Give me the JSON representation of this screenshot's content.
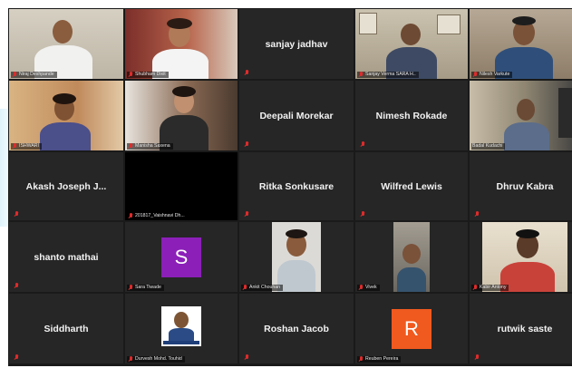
{
  "participants": [
    {
      "name": "Niraj Deshpande",
      "type": "video",
      "bg": "#c9c3b5"
    },
    {
      "name": "Shubham Dixit",
      "type": "video",
      "bg": "#a0523f"
    },
    {
      "name": "sanjay jadhav",
      "type": "name"
    },
    {
      "name": "Sanjay Verma SARA H..",
      "type": "video",
      "bg": "#bfb7a6"
    },
    {
      "name": "Nilesh Varkute",
      "type": "video",
      "bg": "#9a8b78"
    },
    {
      "name": "ISHWARI",
      "type": "video",
      "bg": "#c49b6c"
    },
    {
      "name": "Manisha Saxena",
      "type": "video",
      "bg": "#6b5646"
    },
    {
      "name": "Deepali Morekar",
      "type": "name"
    },
    {
      "name": "Nimesh Rokade",
      "type": "name"
    },
    {
      "name": "Badal Kudachi",
      "type": "video",
      "bg": "#7d7463",
      "active": true
    },
    {
      "name": "Akash Joseph J...",
      "type": "name"
    },
    {
      "name": "201817_Vaishnavi Dh...",
      "type": "blank"
    },
    {
      "name": "Ritka Sonkusare",
      "type": "name"
    },
    {
      "name": "Wilfred Lewis",
      "type": "name"
    },
    {
      "name": "Dhruv Kabra",
      "type": "name"
    },
    {
      "name": "shanto mathai",
      "type": "name"
    },
    {
      "name": "Sara Tiwade",
      "type": "letter",
      "letter": "S",
      "color": "#8b1fb8"
    },
    {
      "name": "Ankit Chouhan",
      "type": "video",
      "bg": "#d4d2cf"
    },
    {
      "name": "Vivek",
      "type": "video",
      "bg": "#8f8a80"
    },
    {
      "name": "Kabir Antony",
      "type": "video",
      "bg": "#ddd3c2"
    },
    {
      "name": "Siddharth",
      "type": "name"
    },
    {
      "name": "Durvesh Mohd. Touhid",
      "type": "badge"
    },
    {
      "name": "Roshan Jacob",
      "type": "name"
    },
    {
      "name": "Reuben Pereira",
      "type": "letter",
      "letter": "R",
      "color": "#f05a1f"
    },
    {
      "name": "rutwik saste",
      "type": "name"
    }
  ]
}
